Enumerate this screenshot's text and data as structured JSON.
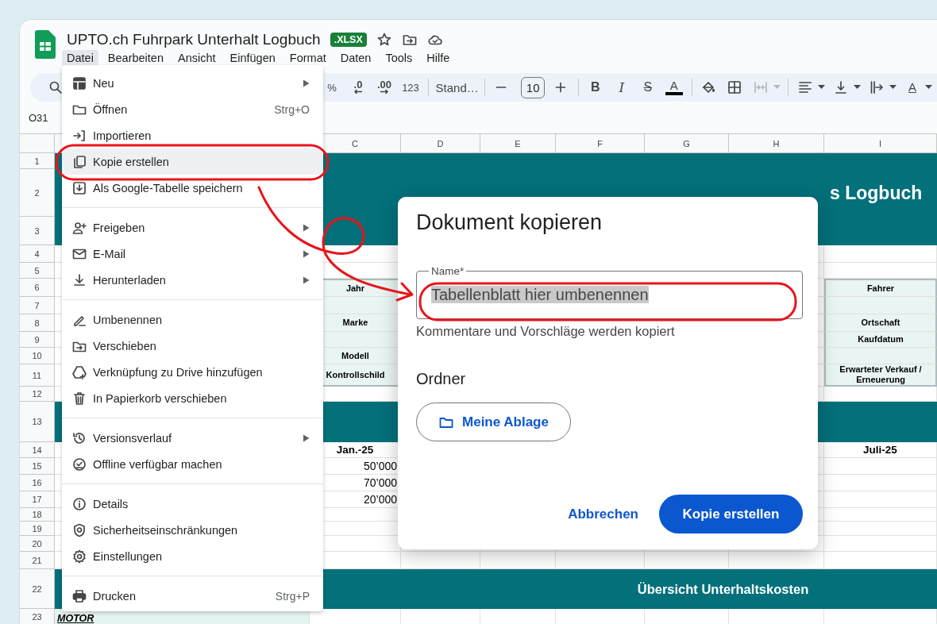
{
  "document": {
    "title": "UPTO.ch Fuhrpark Unterhalt Logbuch",
    "badge": ".XLSX"
  },
  "menubar": [
    {
      "label": "Datei",
      "selected": true
    },
    {
      "label": "Bearbeiten",
      "selected": false
    },
    {
      "label": "Ansicht",
      "selected": false
    },
    {
      "label": "Einfügen",
      "selected": false
    },
    {
      "label": "Format",
      "selected": false
    },
    {
      "label": "Daten",
      "selected": false
    },
    {
      "label": "Tools",
      "selected": false
    },
    {
      "label": "Hilfe",
      "selected": false
    }
  ],
  "toolbar": [
    {
      "kind": "search",
      "disabled": false
    },
    {
      "kind": "text",
      "label": "%",
      "disabled": false
    },
    {
      "kind": "decimal_less",
      "label": ".0",
      "disabled": false
    },
    {
      "kind": "decimal_more",
      "label": ".00",
      "disabled": false
    },
    {
      "kind": "text",
      "label": "123",
      "disabled": false
    },
    {
      "kind": "separator"
    },
    {
      "kind": "dropdown",
      "label": "Stand…",
      "disabled": false
    },
    {
      "kind": "separator"
    },
    {
      "kind": "minus",
      "disabled": false
    },
    {
      "kind": "field",
      "value": "10",
      "disabled": false
    },
    {
      "kind": "plus",
      "disabled": false
    },
    {
      "kind": "separator"
    },
    {
      "kind": "bold",
      "label": "B",
      "disabled": false
    },
    {
      "kind": "italic",
      "label": "I",
      "disabled": false
    },
    {
      "kind": "strike",
      "label": "S",
      "disabled": false
    },
    {
      "kind": "text_color",
      "label": "A",
      "disabled": false
    },
    {
      "kind": "separator"
    },
    {
      "kind": "fill",
      "disabled": false
    },
    {
      "kind": "borders",
      "disabled": false
    },
    {
      "kind": "merge",
      "disabled": true,
      "caret": true
    },
    {
      "kind": "separator"
    },
    {
      "kind": "align",
      "disabled": false,
      "caret": true
    },
    {
      "kind": "valign",
      "disabled": false,
      "caret": true
    },
    {
      "kind": "wrap",
      "disabled": false,
      "caret": true
    },
    {
      "kind": "rotate",
      "label": "A",
      "disabled": false,
      "caret": true
    }
  ],
  "cell_reference": "O31",
  "sheet": {
    "columns": [
      "C",
      "D",
      "E",
      "F",
      "G",
      "H",
      "I"
    ],
    "rows": [
      {
        "label": "1",
        "kind": "band",
        "cells": []
      },
      {
        "label": "2",
        "kind": "band_title",
        "title": "s Logbuch",
        "cells": []
      },
      {
        "label": "3",
        "kind": "band",
        "cells": []
      },
      {
        "label": "4",
        "kind": "plain",
        "cells": []
      },
      {
        "label": "5",
        "kind": "plain",
        "cells": []
      },
      {
        "label": "6",
        "kind": "box",
        "cells": [
          "Jahr",
          "",
          "",
          "",
          "",
          "",
          "Fahrer"
        ]
      },
      {
        "label": "7",
        "kind": "box",
        "cells": []
      },
      {
        "label": "8",
        "kind": "box",
        "cells": [
          "Marke",
          "",
          "",
          "",
          "",
          "",
          "Ortschaft"
        ]
      },
      {
        "label": "9",
        "kind": "box",
        "cells": [
          "",
          "",
          "",
          "",
          "",
          "",
          "Kaufdatum"
        ]
      },
      {
        "label": "10",
        "kind": "box",
        "cells": [
          "Modell"
        ]
      },
      {
        "label": "11",
        "kind": "box",
        "cells": [
          "Kontrollschild",
          "",
          "",
          "",
          "",
          "",
          "Erwarteter Verkauf / Erneuerung"
        ]
      },
      {
        "label": "12",
        "kind": "plain",
        "cells": []
      },
      {
        "label": "13",
        "kind": "band",
        "cells": []
      },
      {
        "label": "14",
        "kind": "month",
        "cells": [
          "Jan.-25",
          "",
          "",
          "",
          "",
          "",
          "Juli-25"
        ]
      },
      {
        "label": "15",
        "kind": "number",
        "cells": [
          "50’000"
        ]
      },
      {
        "label": "16",
        "kind": "number",
        "cells": [
          "70’000"
        ]
      },
      {
        "label": "17",
        "kind": "number",
        "cells": [
          "20’000"
        ]
      },
      {
        "label": "18",
        "kind": "plain",
        "cells": []
      },
      {
        "label": "19",
        "kind": "plain",
        "cells": []
      },
      {
        "label": "20",
        "kind": "plain",
        "cells": []
      },
      {
        "label": "21",
        "kind": "plain",
        "cells": []
      },
      {
        "label": "22",
        "kind": "band_heading",
        "title": "Übersicht Unterhaltskosten",
        "cells": []
      },
      {
        "label": "23",
        "kind": "plain",
        "section": "MOTOR",
        "cells": []
      }
    ]
  },
  "file_menu": [
    {
      "kind": "item",
      "label": "Neu",
      "submenu": true,
      "selected": false
    },
    {
      "kind": "item",
      "label": "Öffnen",
      "shortcut": "Strg+O",
      "submenu": false,
      "selected": false
    },
    {
      "kind": "item",
      "label": "Importieren",
      "submenu": false,
      "selected": false
    },
    {
      "kind": "item",
      "label": "Kopie erstellen",
      "submenu": false,
      "selected": true
    },
    {
      "kind": "item",
      "label": "Als Google-Tabelle speichern",
      "submenu": false,
      "selected": false
    },
    {
      "kind": "separator"
    },
    {
      "kind": "item",
      "label": "Freigeben",
      "submenu": true,
      "selected": false
    },
    {
      "kind": "item",
      "label": "E-Mail",
      "submenu": true,
      "selected": false
    },
    {
      "kind": "item",
      "label": "Herunterladen",
      "submenu": true,
      "selected": false
    },
    {
      "kind": "separator"
    },
    {
      "kind": "item",
      "label": "Umbenennen",
      "submenu": false,
      "selected": false
    },
    {
      "kind": "item",
      "label": "Verschieben",
      "submenu": false,
      "selected": false
    },
    {
      "kind": "item",
      "label": "Verknüpfung zu Drive hinzufügen",
      "submenu": false,
      "selected": false
    },
    {
      "kind": "item",
      "label": "In Papierkorb verschieben",
      "submenu": false,
      "selected": false
    },
    {
      "kind": "separator"
    },
    {
      "kind": "item",
      "label": "Versionsverlauf",
      "submenu": true,
      "selected": false
    },
    {
      "kind": "item",
      "label": "Offline verfügbar machen",
      "submenu": false,
      "selected": false
    },
    {
      "kind": "separator"
    },
    {
      "kind": "item",
      "label": "Details",
      "submenu": false,
      "selected": false
    },
    {
      "kind": "item",
      "label": "Sicherheitseinschränkungen",
      "submenu": false,
      "selected": false
    },
    {
      "kind": "item",
      "label": "Einstellungen",
      "submenu": false,
      "selected": false
    },
    {
      "kind": "separator"
    },
    {
      "kind": "item",
      "label": "Drucken",
      "shortcut": "Strg+P",
      "submenu": false,
      "selected": false
    }
  ],
  "dialog": {
    "title": "Dokument kopieren",
    "name_field": {
      "label": "Name*",
      "value": "Tabellenblatt hier umbenennen",
      "text_selected": true
    },
    "helper": "Kommentare und Vorschläge werden kopiert",
    "folder_heading": "Ordner",
    "folder_button": "Meine Ablage",
    "buttons": [
      {
        "kind": "text",
        "label": "Abbrechen"
      },
      {
        "kind": "filled",
        "label": "Kopie erstellen"
      }
    ]
  },
  "annotations": [
    {
      "kind": "ring"
    },
    {
      "kind": "arrow"
    },
    {
      "kind": "ring"
    }
  ]
}
